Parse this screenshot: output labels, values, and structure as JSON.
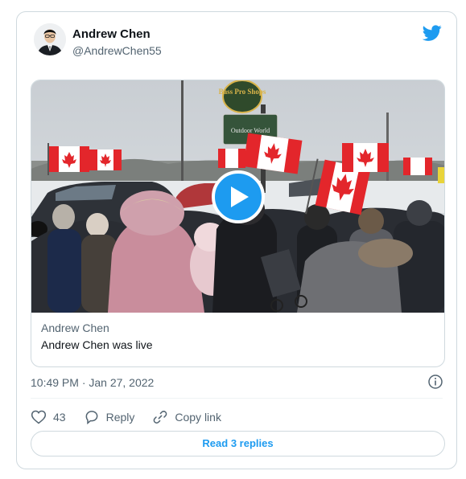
{
  "tweet": {
    "author_name": "Andrew Chen",
    "author_handle": "@AndrewChen55",
    "timestamp": "10:49 PM · Jan 27, 2022",
    "brand_color": "#1d9bf0"
  },
  "media": {
    "card_author": "Andrew Chen",
    "card_title": "Andrew Chen was live",
    "sign_line1": "Bass Pro Shops",
    "sign_line2": "Outdoor World"
  },
  "actions": {
    "likes_count": "43",
    "reply_label": "Reply",
    "copy_link_label": "Copy link"
  },
  "footer": {
    "read_replies_label": "Read 3 replies"
  },
  "icons": [
    "twitter-bird-icon",
    "play-icon",
    "info-icon",
    "heart-icon",
    "reply-bubble-icon",
    "link-icon"
  ]
}
